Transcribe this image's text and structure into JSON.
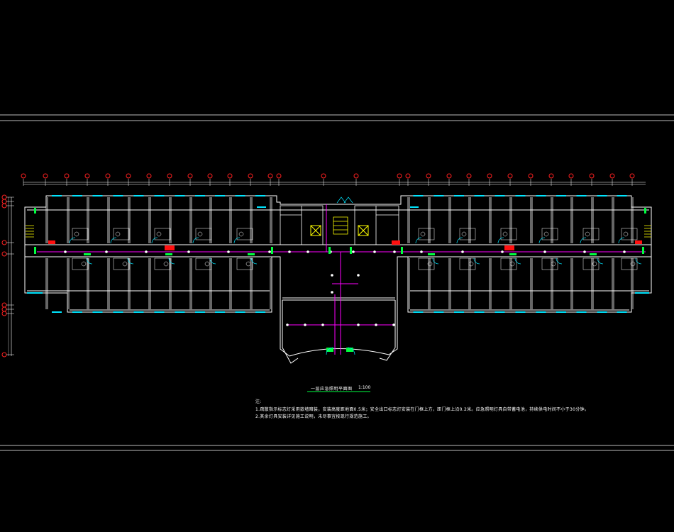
{
  "drawing": {
    "title": "一层应急照明平面图",
    "scale": "1:100",
    "note_label": "注:",
    "notes": [
      "1.疏散指示标志灯采用嵌墙暗装，安装高度距地面0.5米；安全出口标志灯安装在门框上方，距门框上沿0.2米。应急照明灯具自带蓄电池，持续供电时间不小于30分钟。",
      "2.其余灯具安装详见施工说明，未尽事宜按现行规范施工。"
    ]
  },
  "colors": {
    "background": "#000000",
    "wall": "#ffffff",
    "window": "#00e5ff",
    "axis_bubble": "#ff2020",
    "wiring": "#ff00ff",
    "fixture": "#00ff40",
    "panel": "#ff0000",
    "stair": "#ffff00",
    "frame": "#c8c8c8"
  },
  "icons": [
    "axis-bubble",
    "exit-sign",
    "emergency-light",
    "distribution-panel",
    "stair",
    "elevator"
  ]
}
